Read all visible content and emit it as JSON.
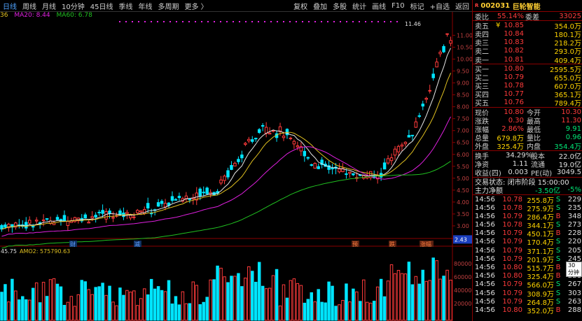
{
  "toolbar": {
    "left": [
      "日线",
      "周线",
      "月线",
      "10分钟",
      "45日线",
      "季线",
      "年线",
      "多周期",
      "更多 〉"
    ],
    "right": [
      "复权",
      "叠加",
      "多股",
      "统计",
      "画线",
      "F10",
      "标记",
      "+自选",
      "返回"
    ]
  },
  "ma_legend": {
    "prefix": "36",
    "ma20": "MA20: 8.44",
    "ma60": "MA60: 6.78"
  },
  "price_axis": {
    "ticks": [
      "11.00",
      "10.50",
      "10.00",
      "9.50",
      "9.00",
      "8.50",
      "8.00",
      "7.50",
      "7.00",
      "6.50",
      "6.00",
      "5.50",
      "5.00",
      "4.50",
      "4.00",
      "3.50",
      "3.00"
    ],
    "current": "2.43",
    "high_label": "11.46"
  },
  "markers": [
    "财",
    "减",
    "预",
    "跌",
    "涨幅"
  ],
  "vol_legend": {
    "v": "45.75",
    "amo2": "AMO2: 575790.63"
  },
  "vol_axis": [
    "80000",
    "60000",
    "40000",
    "20000"
  ],
  "colors": {
    "up": "#ff3b3b",
    "down": "#00e5ff",
    "ma_white": "#e6e6e6",
    "ma_yellow": "#e0c020",
    "ma_magenta": "#e020e0",
    "ma_green": "#20c020"
  },
  "quote": {
    "badge": "R",
    "code": "002031",
    "name": "巨轮智能",
    "weibi_label": "委比",
    "weibi": "55.14%",
    "weicha_label": "委差",
    "weicha": "33025",
    "asks": [
      {
        "label": "卖五",
        "mark": "¥",
        "price": "10.85",
        "vol": "354.0万"
      },
      {
        "label": "卖四",
        "mark": "",
        "price": "10.84",
        "vol": "180.1万"
      },
      {
        "label": "卖三",
        "mark": "",
        "price": "10.83",
        "vol": "218.2万"
      },
      {
        "label": "卖二",
        "mark": "",
        "price": "10.82",
        "vol": "293.0万"
      },
      {
        "label": "卖一",
        "mark": "",
        "price": "10.81",
        "vol": "409.4万"
      }
    ],
    "bids": [
      {
        "label": "买一",
        "price": "10.80",
        "vol": "2595.5万"
      },
      {
        "label": "买二",
        "price": "10.79",
        "vol": "655.0万"
      },
      {
        "label": "买三",
        "price": "10.78",
        "vol": "607.0万"
      },
      {
        "label": "买四",
        "price": "10.77",
        "vol": "365.1万"
      },
      {
        "label": "买五",
        "price": "10.76",
        "vol": "789.4万"
      }
    ],
    "stats": [
      {
        "l1": "现价",
        "v1": "10.80",
        "l2": "今开",
        "v2": "10.30"
      },
      {
        "l1": "涨跌",
        "v1": "0.30",
        "l2": "最高",
        "v2": "11.30"
      },
      {
        "l1": "涨幅",
        "v1": "2.86%",
        "l2": "最低",
        "v2": "9.91"
      },
      {
        "l1": "总量",
        "v1": "679.8万",
        "l2": "量比",
        "v2": "0.96"
      },
      {
        "l1": "外盘",
        "v1": "325.4万",
        "l2": "内盘",
        "v2": "354.4万"
      }
    ],
    "stats2": [
      {
        "l1": "换手",
        "v1": "34.29%",
        "l2": "股本",
        "v2": "22.0亿"
      },
      {
        "l1": "净资",
        "v1": "1.11",
        "l2": "流通",
        "v2": "19.0亿"
      },
      {
        "l1": "收益(四)",
        "v1": "0.003",
        "l2": "PE(动)",
        "v2": "3049.5"
      }
    ],
    "status_label": "交易状态:",
    "status": "闭市阶段 15:00:00",
    "netflow_label": "主力净额",
    "netflow": "-3.50亿",
    "netflow_pct": "-5%"
  },
  "ticks": [
    {
      "t": "14:56",
      "p": "10.78",
      "v": "255.8万",
      "s": "S",
      "n": "229"
    },
    {
      "t": "14:56",
      "p": "10.78",
      "v": "275.9万",
      "s": "S",
      "n": "235"
    },
    {
      "t": "14:56",
      "p": "10.79",
      "v": "286.4万",
      "s": "B",
      "n": "348"
    },
    {
      "t": "14:56",
      "p": "10.78",
      "v": "344.1万",
      "s": "S",
      "n": "273"
    },
    {
      "t": "14:56",
      "p": "10.79",
      "v": "450.1万",
      "s": "B",
      "n": "228"
    },
    {
      "t": "14:56",
      "p": "10.79",
      "v": "170.4万",
      "s": "S",
      "n": "220"
    },
    {
      "t": "14:56",
      "p": "10.79",
      "v": "371.1万",
      "s": "S",
      "n": "205"
    },
    {
      "t": "14:56",
      "p": "10.79",
      "v": "201.9万",
      "s": "S",
      "n": "245"
    },
    {
      "t": "14:56",
      "p": "10.80",
      "v": "515.7万",
      "s": "B",
      "n": "406"
    },
    {
      "t": "14:56",
      "p": "10.80",
      "v": "325.4万",
      "s": "B",
      "n": "221"
    },
    {
      "t": "14:56",
      "p": "10.79",
      "v": "566.0万",
      "s": "S",
      "n": "267"
    },
    {
      "t": "14:56",
      "p": "10.79",
      "v": "308.9万",
      "s": "S",
      "n": "303"
    },
    {
      "t": "14:56",
      "p": "10.79",
      "v": "264.8万",
      "s": "S",
      "n": "263"
    },
    {
      "t": "14:56",
      "p": "10.80",
      "v": "352.0万",
      "s": "B",
      "n": "288"
    }
  ],
  "tooltip": "30分钟"
}
